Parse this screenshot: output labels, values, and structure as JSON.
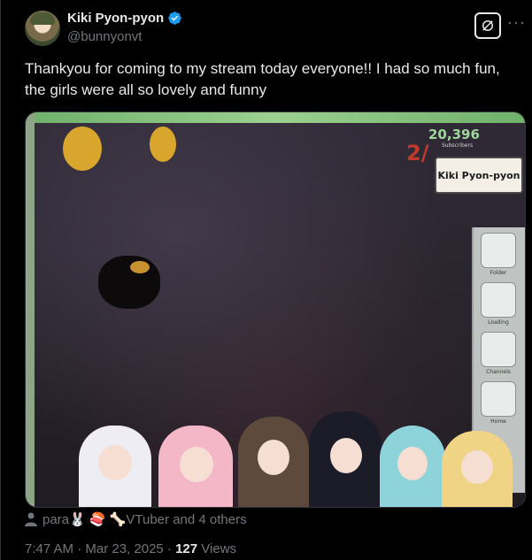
{
  "author": {
    "display_name": "Kiki Pyon-pyon",
    "handle": "@bunnyonvt",
    "verified_icon": "verified-badge-icon",
    "verified_color": "#1d9bf0"
  },
  "tweet": {
    "text": "Thankyou for coming to my stream today everyone!! I had so much fun, the girls were all so lovely and funny"
  },
  "media": {
    "overlay": {
      "subscriber_count": "20,396",
      "subscriber_label": "Subscribers",
      "goal_mark": "2/",
      "logo_text": "Kiki Pyon-pyon",
      "sidebar_buttons": [
        "Folder",
        "Loading",
        "Channels",
        "Home"
      ]
    }
  },
  "tagged": {
    "icon": "person-icon",
    "text": "para🐰 🍣 🦴VTuber and 4 others"
  },
  "meta": {
    "time": "7:47 AM · Mar 23, 2025 · ",
    "views_count": "127",
    "views_label": " Views"
  },
  "colors": {
    "background": "#000000",
    "text_primary": "#e7e9ea",
    "text_secondary": "#71767b",
    "accent": "#1d9bf0"
  }
}
